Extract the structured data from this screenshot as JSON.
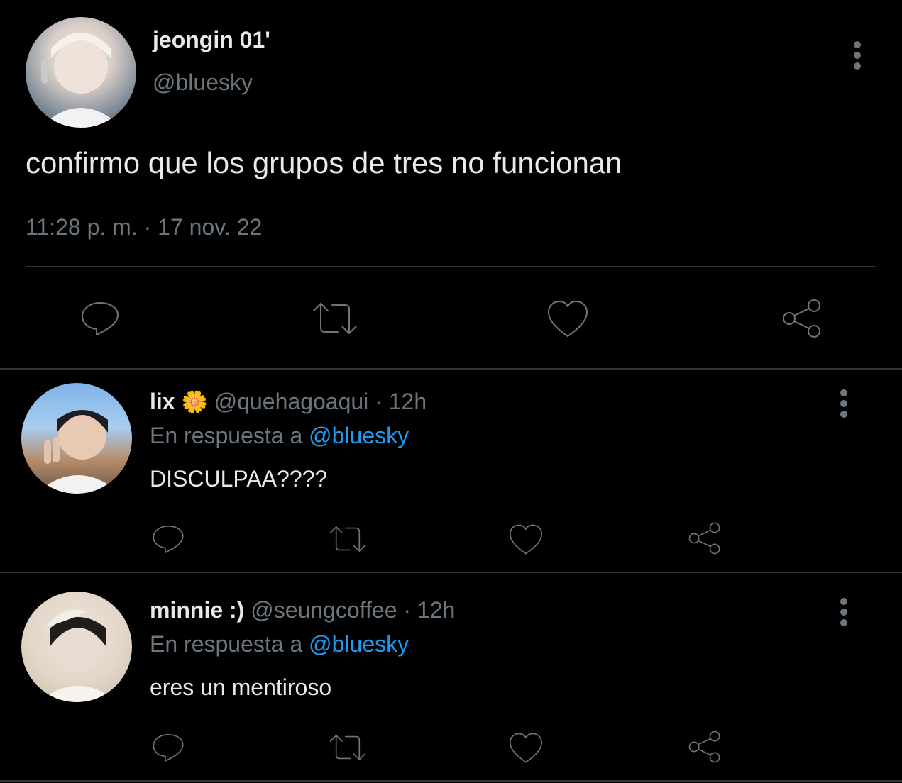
{
  "main_tweet": {
    "display_name": "jeongin 01'",
    "handle": "@bluesky",
    "text": "confirmo que los grupos de tres no funcionan",
    "timestamp": "11:28 p. m. · 17 nov. 22"
  },
  "replies": [
    {
      "display_name": "lix",
      "emoji": "🌼",
      "handle": "@quehagoaqui",
      "separator": "·",
      "time": "12h",
      "reply_prefix": "En respuesta a",
      "reply_to": "@bluesky",
      "text": "DISCULPAA????"
    },
    {
      "display_name": "minnie :)",
      "handle": "@seungcoffee",
      "separator": "·",
      "time": "12h",
      "reply_prefix": "En respuesta a",
      "reply_to": "@bluesky",
      "text": "eres un mentiroso"
    }
  ],
  "colors": {
    "background": "#000000",
    "text": "#e7e9ea",
    "muted": "#6e767d",
    "link": "#1d9bf0",
    "divider": "#2f3336"
  },
  "icons": [
    "reply-icon",
    "retweet-icon",
    "like-icon",
    "share-icon",
    "more-icon"
  ]
}
